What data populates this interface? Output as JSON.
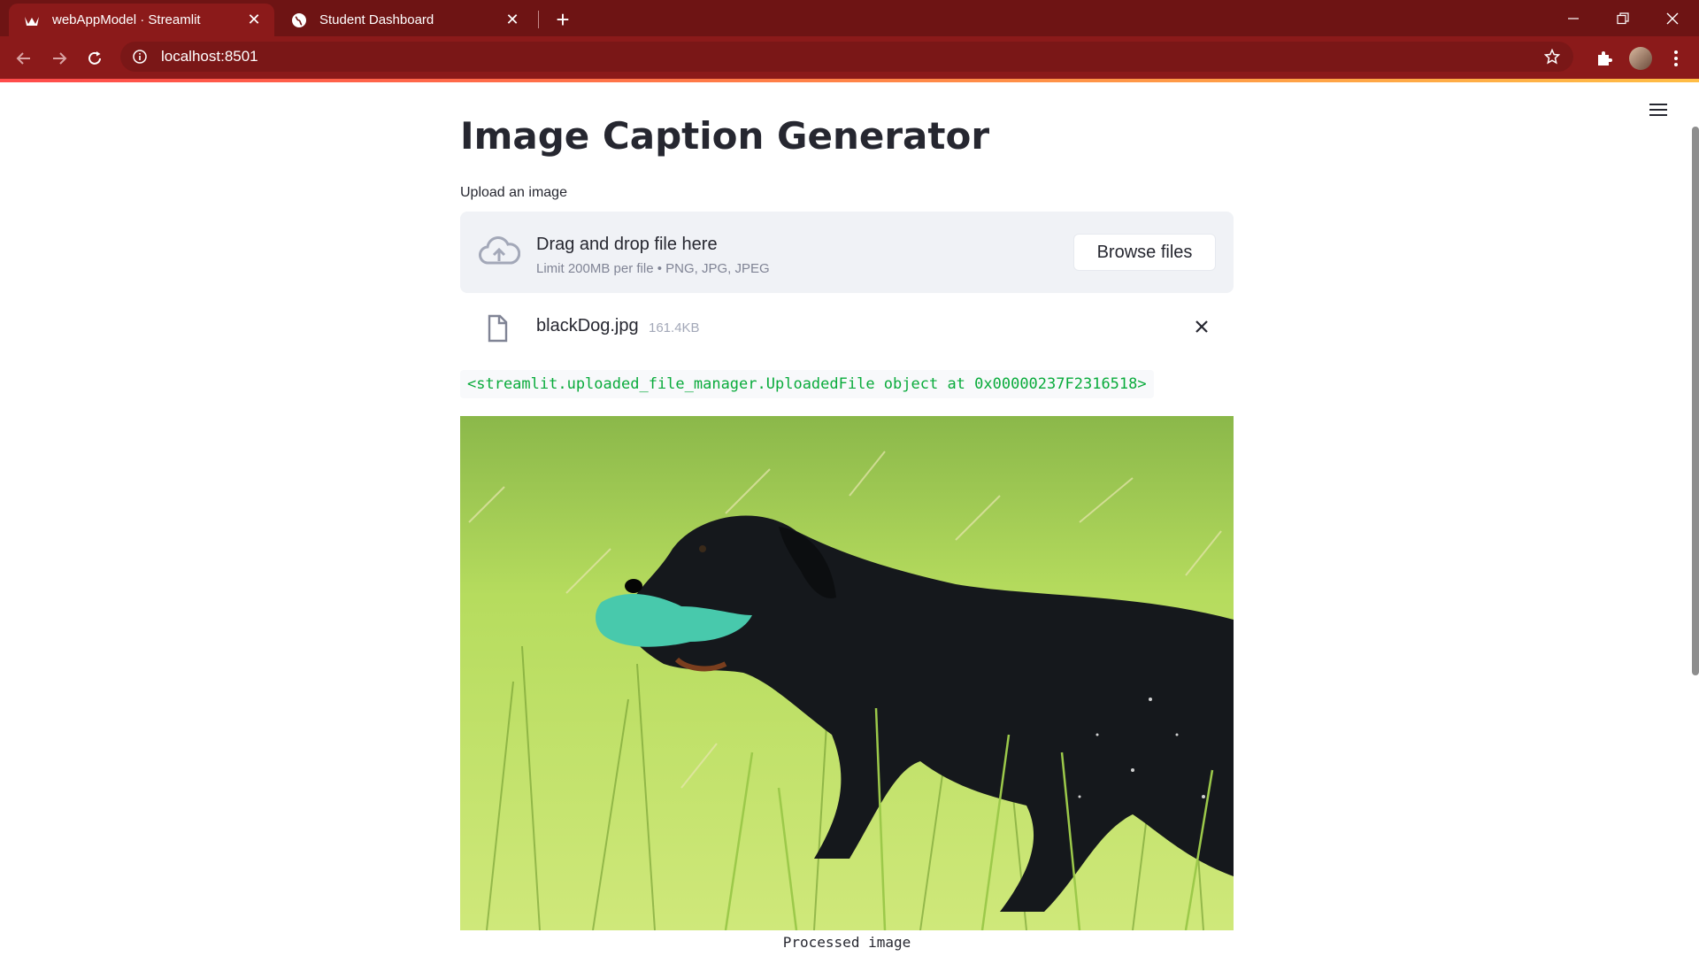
{
  "browser": {
    "tabs": [
      {
        "title": "webAppModel · Streamlit",
        "active": true
      },
      {
        "title": "Student Dashboard",
        "active": false
      }
    ],
    "url": "localhost:8501"
  },
  "app": {
    "title": "Image Caption Generator",
    "uploader": {
      "label": "Upload an image",
      "drop_title": "Drag and drop file here",
      "drop_subtitle": "Limit 200MB per file • PNG, JPG, JPEG",
      "browse_label": "Browse files"
    },
    "uploaded_file": {
      "name": "blackDog.jpg",
      "size": "161.4KB"
    },
    "object_repr": "<streamlit.uploaded_file_manager.UploadedFile object at 0x00000237F2316518>",
    "image_caption": "Processed image"
  },
  "colors": {
    "tabbar": "#6e1414",
    "toolbar": "#8b1a1a",
    "code_text": "#09ab3b"
  }
}
